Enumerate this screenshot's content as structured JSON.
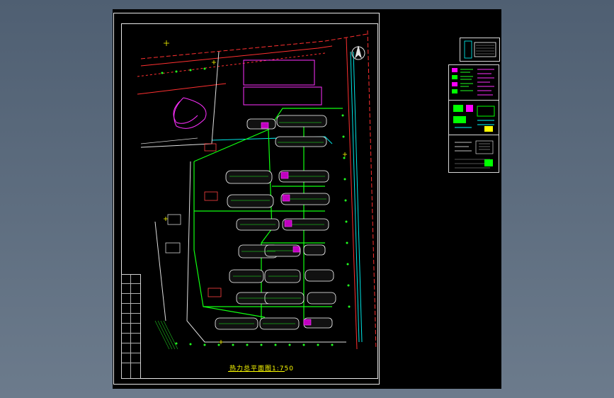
{
  "drawing": {
    "title": "热力总平面图1:750"
  },
  "colors": {
    "background": "#5d6d80",
    "model_space": "#000000",
    "frame": "#e8e8e8",
    "heating_pipe": "#00ff00",
    "buildings": "#ffffff",
    "road_red": "#ff2020",
    "magenta": "#ff00ff",
    "cyan": "#00ffff",
    "title_text": "#ffff00"
  },
  "icons": {
    "north_arrow": "north-arrow-icon"
  }
}
